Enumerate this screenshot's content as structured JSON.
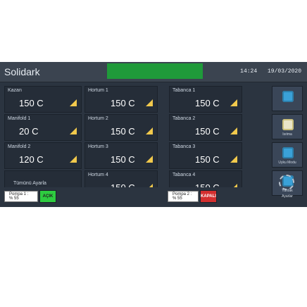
{
  "app": {
    "title": "Solidark",
    "time": "14:24",
    "date": "19/03/2020"
  },
  "colors": {
    "accent_green": "#1f9a3a",
    "warn_yellow": "#f2c94c",
    "ok_green": "#2ecc40",
    "alarm_red": "#d32f2f"
  },
  "left_column": [
    {
      "title": "Kazan",
      "value": "150 C"
    },
    {
      "title": "Manifold 1",
      "value": "20 C"
    },
    {
      "title": "Manifold 2",
      "value": "120 C"
    },
    {
      "title": "Tümünü Ayarla",
      "value": ""
    }
  ],
  "hortum": [
    {
      "title": "Hortum 1",
      "value": "150 C"
    },
    {
      "title": "Hortum 2",
      "value": "150 C"
    },
    {
      "title": "Hortum 3",
      "value": "150 C"
    },
    {
      "title": "Hortum 4",
      "value": "150 C"
    }
  ],
  "tabanca": [
    {
      "title": "Tabanca 1",
      "value": "150 C"
    },
    {
      "title": "Tabanca 2",
      "value": "150 C"
    },
    {
      "title": "Tabanca 3",
      "value": "150 C"
    },
    {
      "title": "Tabanca 4",
      "value": "150 C"
    }
  ],
  "sidebar": {
    "items": [
      {
        "label": "",
        "icon": "thermometer-icon"
      },
      {
        "label": "Isıtma",
        "icon": "heater-icon"
      },
      {
        "label": "Uyku Modu",
        "icon": "sleep-icon"
      },
      {
        "label": "Yardak",
        "icon": "help-icon"
      }
    ],
    "settings_label": "Ayarlar"
  },
  "pumps": [
    {
      "label": "Pompa 1 : % 55",
      "state": "AÇIK"
    },
    {
      "label": "Pompa 2 : % 55",
      "state": "KAPALI"
    }
  ]
}
